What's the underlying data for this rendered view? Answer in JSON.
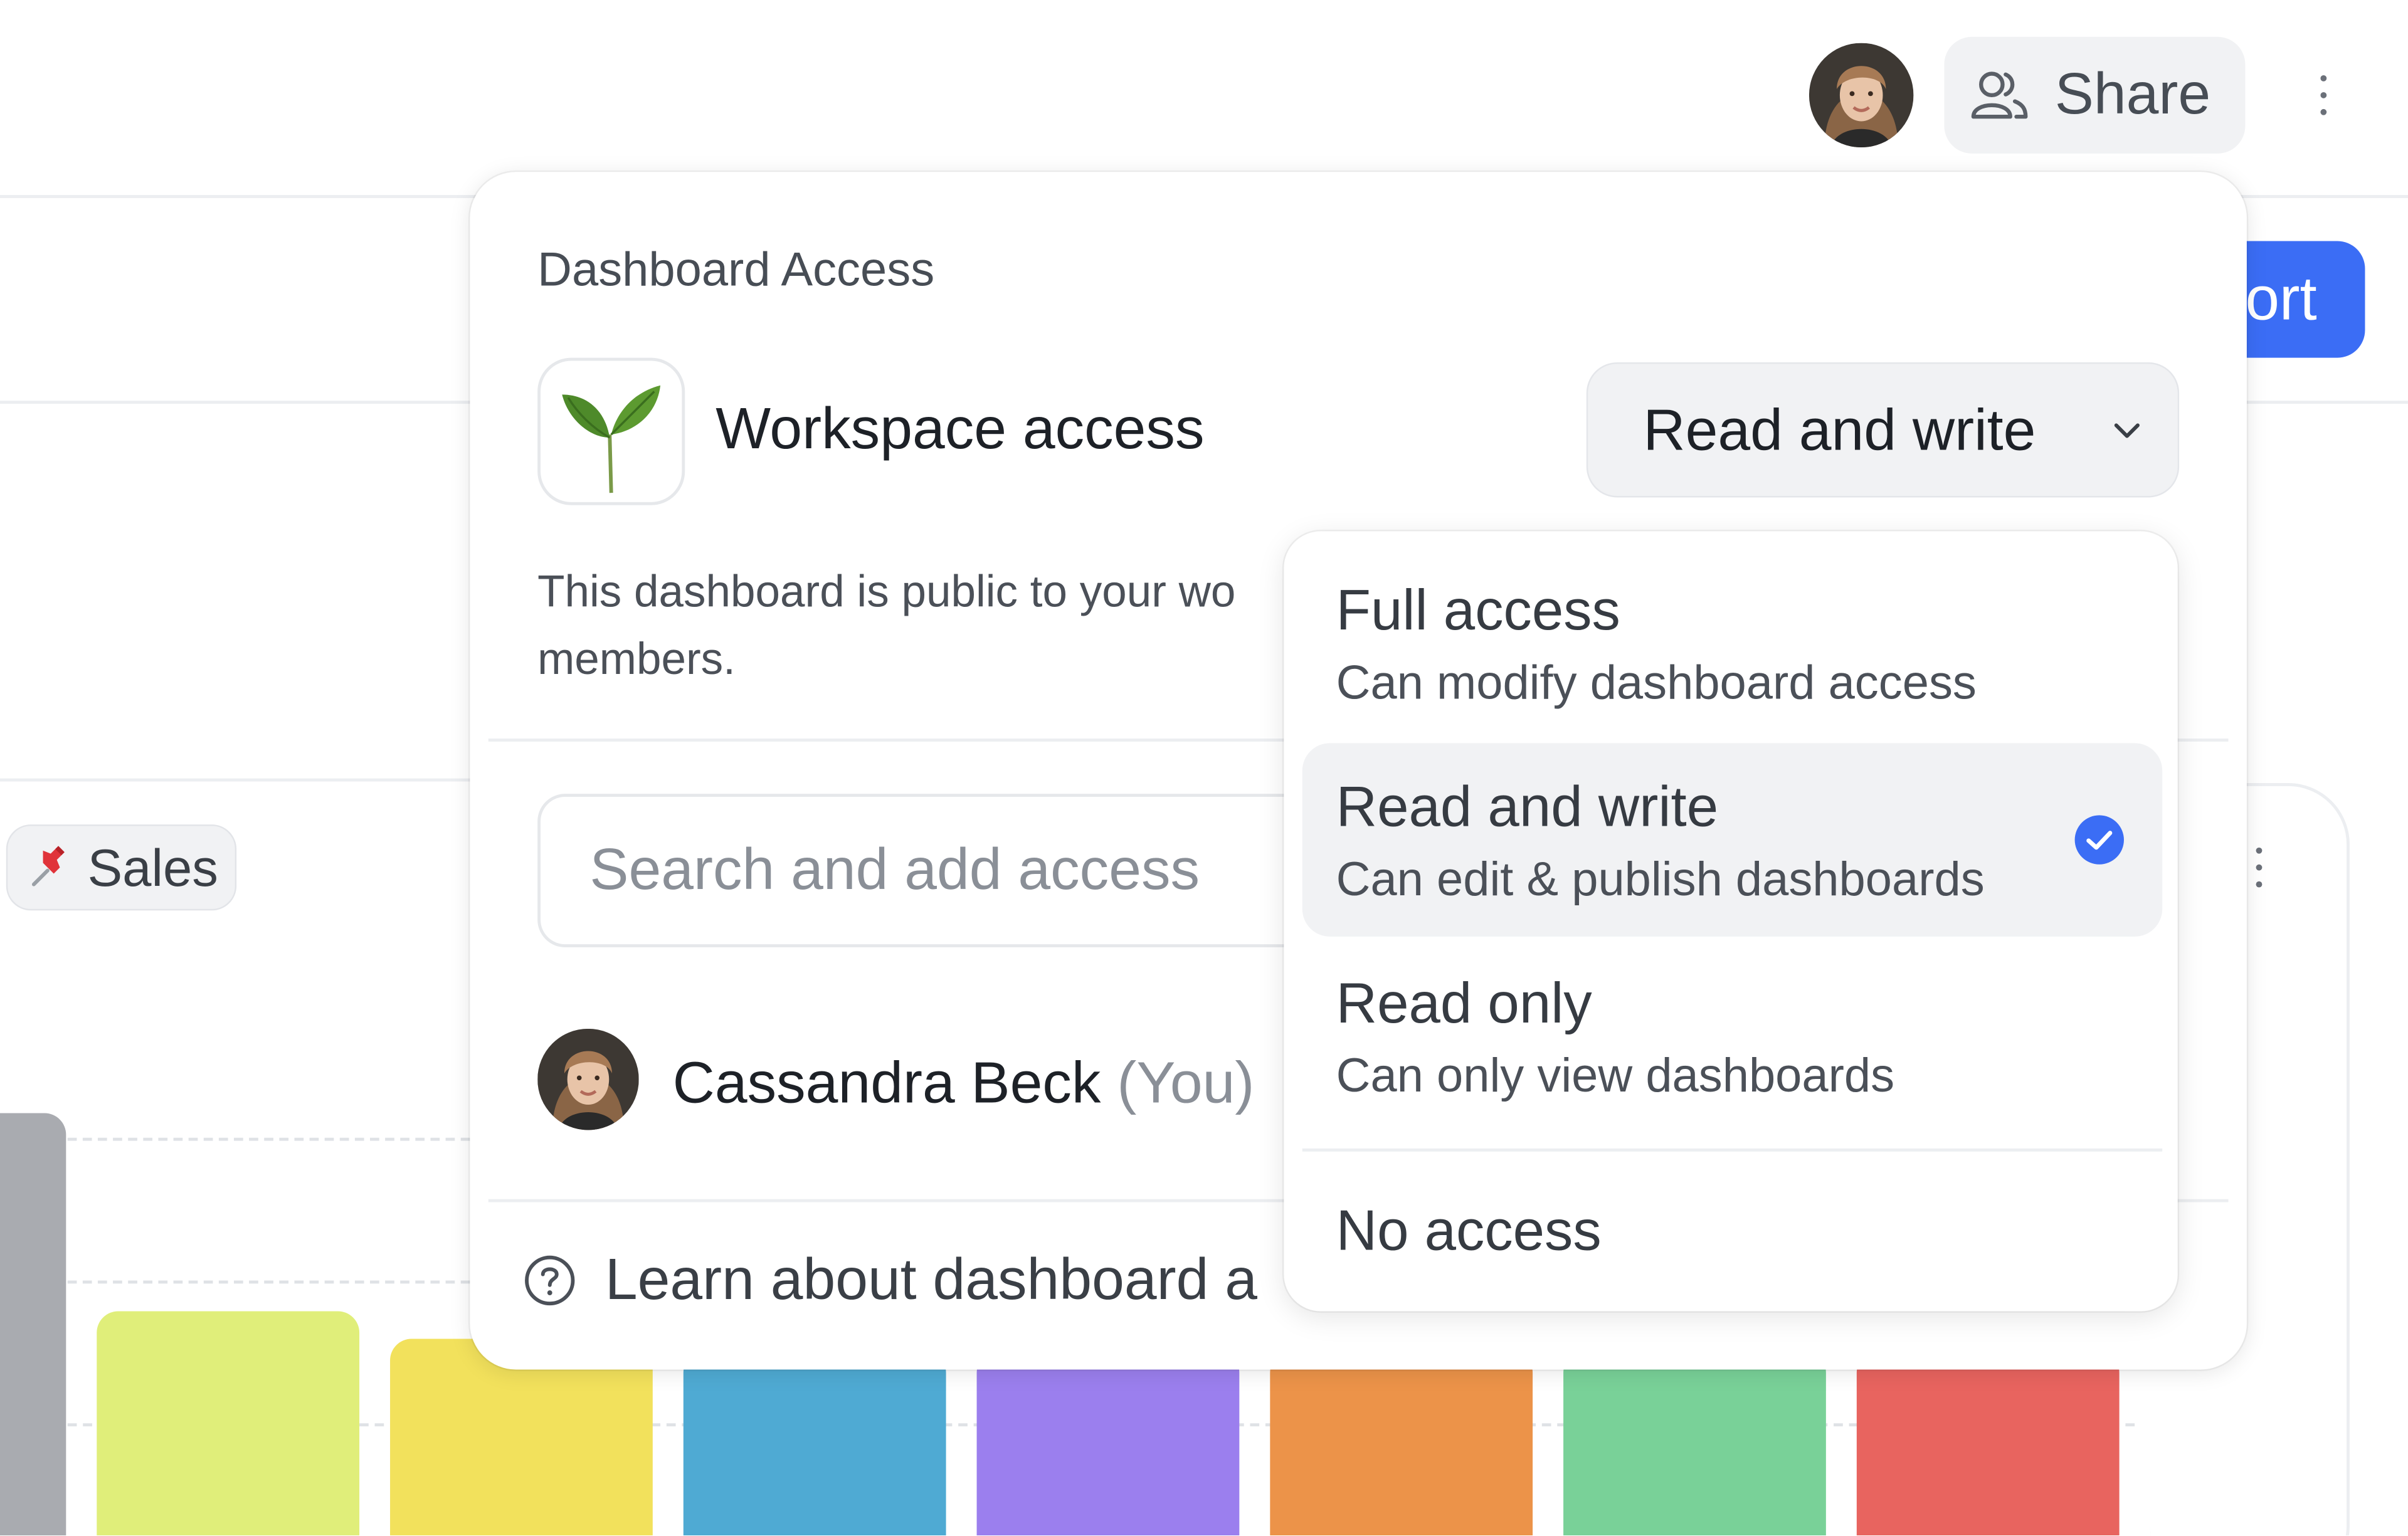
{
  "header": {
    "share_label": "Share",
    "export_label_visible": "ort",
    "user_avatar": "user-avatar-portrait"
  },
  "background": {
    "chip_label": "Sales",
    "chip_icon": "pushpin-icon",
    "bar_colors": [
      "#a9abb0",
      "#e0ee7a",
      "#f2e15c",
      "#4faad3",
      "#9b7fee",
      "#ec9349",
      "#79d198",
      "#e8645f"
    ]
  },
  "popover": {
    "title": "Dashboard Access",
    "workspace_label": "Workspace access",
    "workspace_icon": "seedling-icon",
    "permission_value": "Read and write",
    "description_line1": "This dashboard is public to your wo",
    "description_line2": "members.",
    "search_placeholder": "Search and add access",
    "member_name": "Cassandra Beck",
    "member_you": "(You)",
    "help_text": "Learn about dashboard a"
  },
  "menu": {
    "options": [
      {
        "title": "Full access",
        "subtitle": "Can modify dashboard access",
        "selected": false
      },
      {
        "title": "Read and write",
        "subtitle": "Can edit & publish dashboards",
        "selected": true
      },
      {
        "title": "Read only",
        "subtitle": "Can only view dashboards",
        "selected": false
      },
      {
        "title": "No access",
        "subtitle": "",
        "selected": false
      }
    ]
  },
  "colors": {
    "accent": "#3b6df5",
    "selected_bg": "#f1f2f4"
  }
}
